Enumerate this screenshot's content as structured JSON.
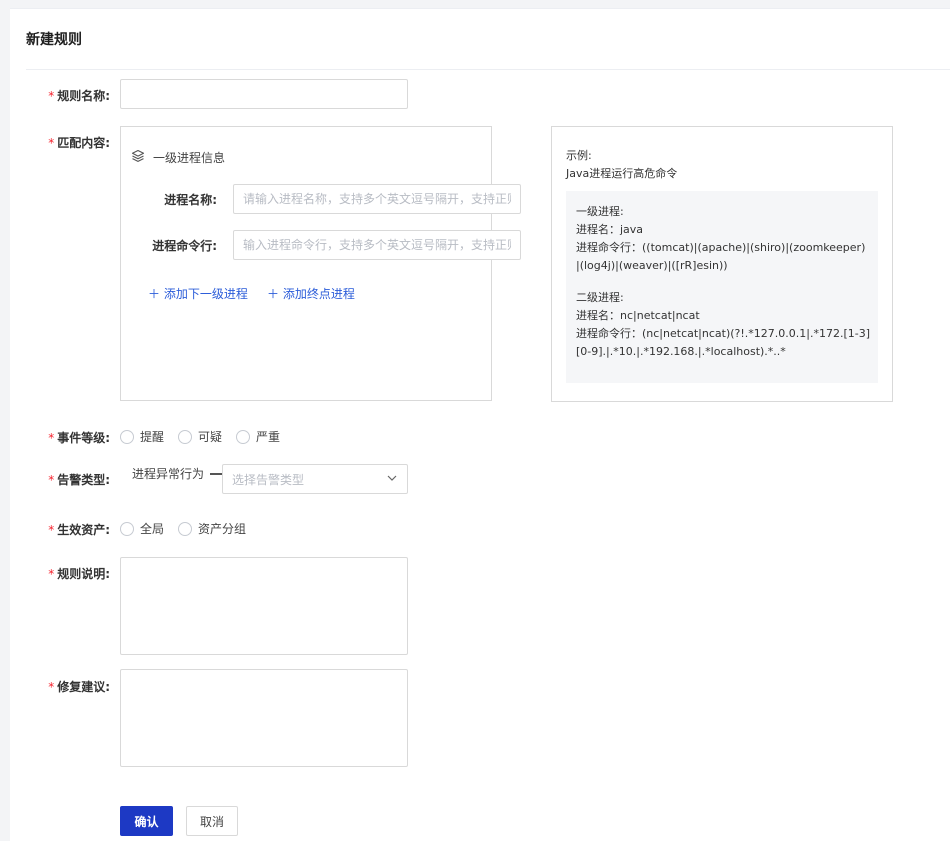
{
  "page": {
    "title": "新建规则"
  },
  "form": {
    "rule_name": {
      "label": "规则名称:",
      "value": "",
      "placeholder": ""
    },
    "match": {
      "label": "匹配内容:",
      "group_title": "一级进程信息",
      "process_name": {
        "label": "进程名称:",
        "placeholder": "请输入进程名称，支持多个英文逗号隔开，支持正则"
      },
      "process_cmd": {
        "label": "进程命令行:",
        "placeholder": "输入进程命令行，支持多个英文逗号隔开，支持正则"
      },
      "add_next_level": "＋ 添加下一级进程",
      "add_end_process": "＋ 添加终点进程"
    },
    "example": {
      "title": "示例:",
      "subtitle": "Java进程运行高危命令",
      "level1": {
        "heading": "一级进程:",
        "name_line": "进程名：java",
        "cmd_line_1": "进程命令行：((tomcat)|(apache)|(shiro)|(zoomkeeper)",
        "cmd_line_2": "|(log4j)|(weaver)|([rR]esin))"
      },
      "level2": {
        "heading": "二级进程:",
        "name_line": "进程名：nc|netcat|ncat",
        "cmd_line_1": "进程命令行：(nc|netcat|ncat)(?!.*127.0.0.1|.*172.[1-3]",
        "cmd_line_2": "[0-9].|.*10.|.*192.168.|.*localhost).*..*"
      }
    },
    "event_level": {
      "label": "事件等级:",
      "options": [
        "提醒",
        "可疑",
        "严重"
      ]
    },
    "alarm_type": {
      "label": "告警类型:",
      "prefix": "进程异常行为",
      "placeholder": "选择告警类型"
    },
    "effective_assets": {
      "label": "生效资产:",
      "options": [
        "全局",
        "资产分组"
      ]
    },
    "rule_desc": {
      "label": "规则说明:",
      "value": ""
    },
    "fix_advice": {
      "label": "修复建议:",
      "value": ""
    }
  },
  "actions": {
    "confirm": "确认",
    "cancel": "取消"
  },
  "colors": {
    "primary": "#1d39c4",
    "link": "#2b5cd9",
    "required": "#f5222d"
  }
}
